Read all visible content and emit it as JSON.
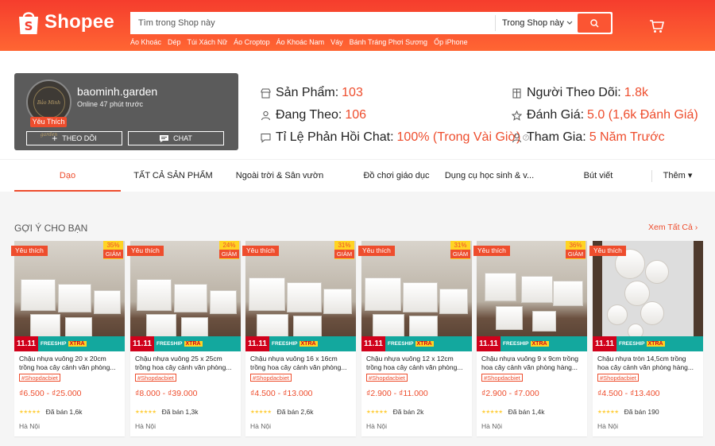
{
  "header": {
    "logo_text": "Shopee",
    "search_placeholder": "Tìm trong Shop này",
    "search_scope": "Trong Shop này",
    "keywords": [
      "Áo Khoác",
      "Dép",
      "Túi Xách Nữ",
      "Áo Croptop",
      "Áo Khoác Nam",
      "Váy",
      "Bánh Tráng Phơi Sương",
      "Ốp iPhone"
    ]
  },
  "shop": {
    "avatar_text": "Bảo Minh garden",
    "favorite_badge": "Yêu Thích",
    "name": "baominh.garden",
    "online": "Online 47 phút trước",
    "follow_label": "THEO DÕI",
    "chat_label": "CHAT",
    "stats": {
      "products_label": "Sản Phẩm:",
      "products_value": "103",
      "following_label": "Đang Theo:",
      "following_value": "106",
      "response_label": "Tỉ Lệ Phản Hồi Chat:",
      "response_value": "100% (Trong Vài Giờ)",
      "followers_label": "Người Theo Dõi:",
      "followers_value": "1.8k",
      "rating_label": "Đánh Giá:",
      "rating_value": "5.0 (1,6k Đánh Giá)",
      "joined_label": "Tham Gia:",
      "joined_value": "5 Năm Trước"
    }
  },
  "tabs": [
    "Dạo",
    "TẤT CẢ SẢN PHẨM",
    "Ngoài trời & Sân vườn",
    "Đồ chơi giáo dục",
    "Dụng cụ học sinh & v...",
    "Bút viết",
    "Thêm ▾"
  ],
  "section": {
    "title": "GỢI Ý CHO BẠN",
    "see_all": "Xem Tất Cả"
  },
  "products": [
    {
      "fav": "Yêu thích",
      "discount": "35%",
      "off": "GIẢM",
      "promo_left": "11.11",
      "promo_free": "FREESHIP",
      "promo_xtra": "XTRA",
      "name": "Chậu nhựa vuông 20 x 20cm trồng hoa cây cảnh văn phòng...",
      "tag": "#Shopdacbiet",
      "price": "₫6.500 - ₫25.000",
      "sold": "Đã bán 1,6k",
      "location": "Hà Nội"
    },
    {
      "fav": "Yêu thích",
      "discount": "24%",
      "off": "GIẢM",
      "promo_left": "11.11",
      "promo_free": "FREESHIP",
      "promo_xtra": "XTRA",
      "name": "Chậu nhựa vuông 25 x 25cm trồng hoa cây cảnh văn phòng...",
      "tag": "#Shopdacbiet",
      "price": "₫8.000 - ₫39.000",
      "sold": "Đã bán 1,3k",
      "location": "Hà Nội"
    },
    {
      "fav": "Yêu thích",
      "discount": "31%",
      "off": "GIẢM",
      "promo_left": "11.11",
      "promo_free": "FREESHIP",
      "promo_xtra": "XTRA",
      "name": "Chậu nhựa vuông 16 x 16cm trồng hoa cây cảnh văn phòng...",
      "tag": "#Shopdacbiet",
      "price": "₫4.500 - ₫13.000",
      "sold": "Đã bán 2,6k",
      "location": "Hà Nội"
    },
    {
      "fav": "Yêu thích",
      "discount": "31%",
      "off": "GIẢM",
      "promo_left": "11.11",
      "promo_free": "FREESHIP",
      "promo_xtra": "XTRA",
      "name": "Chậu nhựa vuông 12 x 12cm trồng hoa cây cảnh văn phòng...",
      "tag": "#Shopdacbiet",
      "price": "₫2.900 - ₫11.000",
      "sold": "Đã bán 2k",
      "location": "Hà Nội"
    },
    {
      "fav": "Yêu thích",
      "discount": "36%",
      "off": "GIẢM",
      "promo_left": "11.11",
      "promo_free": "FREESHIP",
      "promo_xtra": "XTRA",
      "name": "Chậu nhựa vuông 9 x 9cm trồng hoa cây cảnh văn phòng hàng...",
      "tag": "#Shopdacbiet",
      "price": "₫2.900 - ₫7.000",
      "sold": "Đã bán 1,4k",
      "location": "Hà Nội"
    },
    {
      "fav": "Yêu thích",
      "discount": "",
      "off": "",
      "promo_left": "11.11",
      "promo_free": "FREESHIP",
      "promo_xtra": "XTRA",
      "name": "Chậu nhựa tròn 14,5cm trồng hoa cây cảnh văn phòng hàng...",
      "tag": "#Shopdacbiet",
      "price": "₫4.500 - ₫13.400",
      "sold": "Đã bán 190",
      "location": "Hà Nội"
    }
  ],
  "rating_stars": "★★★★★",
  "colors": {
    "brand": "#ee4d2d",
    "header_top": "#f53d2d",
    "header_bottom": "#ff6633",
    "star": "#ffce3d"
  }
}
